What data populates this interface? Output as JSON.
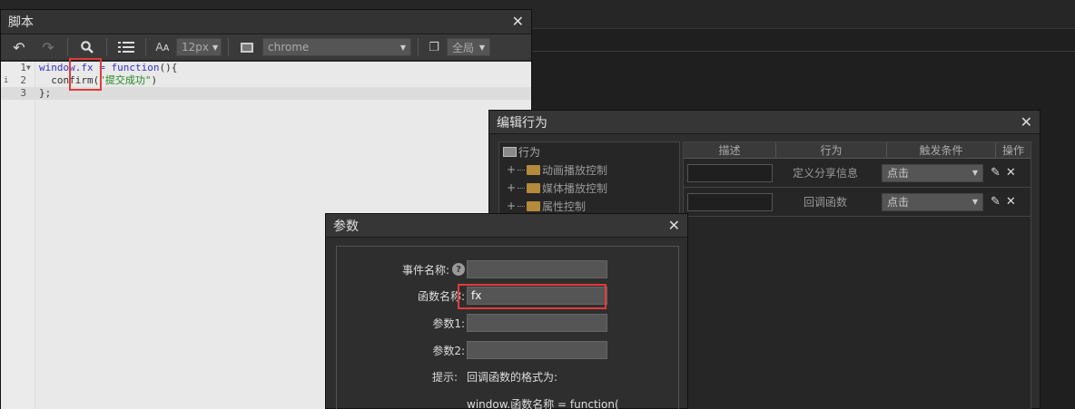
{
  "script_window": {
    "title": "脚本",
    "toolbar": {
      "font_size": "12px",
      "browser": "chrome",
      "scope": "全局"
    },
    "code_lines": [
      {
        "num": "1",
        "prefix": "window.fx = ",
        "keyword": "function",
        "suffix": "(){"
      },
      {
        "num": "2",
        "prefix": "  confirm(",
        "string": "\"提交成功\"",
        "suffix": ")"
      },
      {
        "num": "3",
        "text": "};"
      }
    ]
  },
  "behavior_window": {
    "title": "编辑行为",
    "tree": {
      "root": "行为",
      "items": [
        "动画播放控制",
        "媒体播放控制",
        "属性控制"
      ]
    },
    "table": {
      "headers": [
        "描述",
        "行为",
        "触发条件",
        "操作"
      ],
      "rows": [
        {
          "behavior": "定义分享信息",
          "trigger": "点击"
        },
        {
          "behavior": "回调函数",
          "trigger": "点击"
        }
      ]
    }
  },
  "param_dialog": {
    "title": "参数",
    "fields": {
      "event_name_label": "事件名称:",
      "function_name_label": "函数名称:",
      "function_name_value": "fx",
      "param1_label": "参数1:",
      "param2_label": "参数2:",
      "tip_label": "提示:",
      "tip_text": "回调函数的格式为:",
      "tip_code": "window.函数名称 = function("
    }
  }
}
